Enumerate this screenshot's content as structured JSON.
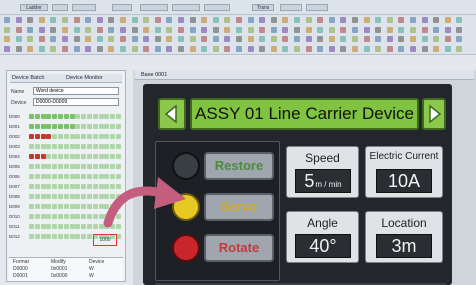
{
  "toolbar": {
    "row1_buttons": [
      "Ladder Monitor",
      "",
      "",
      "",
      "",
      "",
      "",
      "",
      "",
      "",
      "",
      "Trans"
    ],
    "row2_count": 40
  },
  "side_panel": {
    "tab_left": "Device Batch",
    "tab_right": "Device Monitor",
    "field1_label": "Name",
    "field1_value": "Word device",
    "field2_label": "Device",
    "field2_value": "D0000-D0009",
    "row_labels": [
      "D000",
      "D001",
      "D002",
      "D003",
      "D004",
      "D005",
      "D006",
      "D007",
      "D008",
      "D009",
      "D010",
      "D011",
      "D012"
    ],
    "grid_fill": [
      [
        1,
        1,
        1,
        1,
        1,
        1,
        1,
        1,
        2,
        2,
        2,
        2,
        2,
        2,
        2,
        2
      ],
      [
        1,
        1,
        1,
        1,
        1,
        1,
        1,
        1,
        2,
        2,
        2,
        2,
        2,
        2,
        2,
        2
      ],
      [
        3,
        3,
        3,
        3,
        2,
        2,
        2,
        2,
        2,
        2,
        2,
        2,
        2,
        2,
        2,
        2
      ],
      [
        2,
        2,
        2,
        2,
        2,
        2,
        2,
        2,
        2,
        2,
        2,
        2,
        2,
        2,
        2,
        2
      ],
      [
        3,
        3,
        3,
        2,
        2,
        2,
        2,
        2,
        2,
        2,
        2,
        2,
        2,
        2,
        2,
        2
      ],
      [
        2,
        2,
        2,
        2,
        2,
        2,
        2,
        2,
        2,
        2,
        2,
        2,
        2,
        2,
        2,
        2
      ],
      [
        2,
        2,
        2,
        2,
        2,
        2,
        2,
        2,
        2,
        2,
        2,
        2,
        2,
        2,
        2,
        2
      ],
      [
        2,
        2,
        2,
        2,
        2,
        2,
        2,
        2,
        2,
        2,
        2,
        2,
        2,
        2,
        2,
        2
      ],
      [
        2,
        2,
        2,
        2,
        2,
        2,
        2,
        2,
        2,
        2,
        2,
        2,
        2,
        2,
        2,
        2
      ],
      [
        2,
        2,
        2,
        2,
        2,
        2,
        2,
        2,
        2,
        2,
        2,
        2,
        2,
        2,
        2,
        2
      ],
      [
        2,
        2,
        2,
        2,
        2,
        2,
        2,
        2,
        2,
        2,
        2,
        2,
        2,
        2,
        2,
        2
      ],
      [
        2,
        2,
        2,
        2,
        2,
        2,
        2,
        2,
        2,
        2,
        2,
        2,
        2,
        2,
        2,
        2
      ],
      [
        2,
        2,
        2,
        2,
        2,
        2,
        2,
        2,
        2,
        2,
        2,
        2,
        2,
        2,
        2,
        2
      ]
    ],
    "highlight_label": "1000",
    "footer_cols": [
      "Format",
      "Modify",
      "Device"
    ],
    "footer_rows": [
      [
        "D0000",
        "0x0001",
        "W"
      ],
      [
        "D0001",
        "0x0000",
        "W"
      ]
    ]
  },
  "canvas_tab": "Base 0001",
  "hmi": {
    "title": "ASSY 01 Line Carrier Device",
    "nav_left_icon": "arrow-left-icon",
    "nav_right_icon": "arrow-right-icon",
    "buttons": [
      {
        "label": "Restore",
        "lamp_color": "#2b2f33",
        "text_color": "#4d8a3e"
      },
      {
        "label": "Servo",
        "lamp_color": "#e8c823",
        "text_color": "#d0ad2a"
      },
      {
        "label": "Rotate",
        "lamp_color": "#c8262a",
        "text_color": "#c43a3a"
      }
    ],
    "tiles": [
      {
        "label": "Speed",
        "value": "5",
        "unit": "m / min"
      },
      {
        "label": "Electric Current",
        "value": "10A",
        "unit": ""
      },
      {
        "label": "Angle",
        "value": "40°",
        "unit": ""
      },
      {
        "label": "Location",
        "value": "3m",
        "unit": ""
      }
    ]
  },
  "colors": {
    "title_bar": "#7fc341",
    "arrow": "#c55d7e",
    "grid_green": "#7cc06a",
    "grid_red": "#c0392b"
  }
}
